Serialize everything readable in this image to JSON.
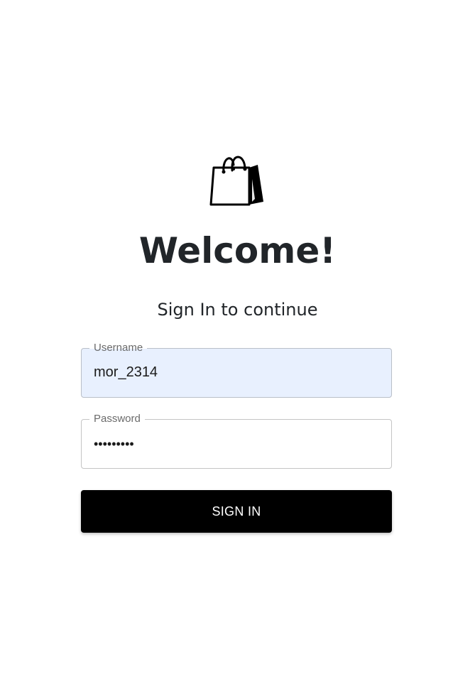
{
  "logo": {
    "icon": "shopping-bag-icon"
  },
  "header": {
    "title": "Welcome!",
    "subtitle": "Sign In to continue"
  },
  "form": {
    "username": {
      "label": "Username",
      "value": "mor_2314"
    },
    "password": {
      "label": "Password",
      "value": "•••••••••"
    },
    "submit_label": "SIGN IN"
  }
}
